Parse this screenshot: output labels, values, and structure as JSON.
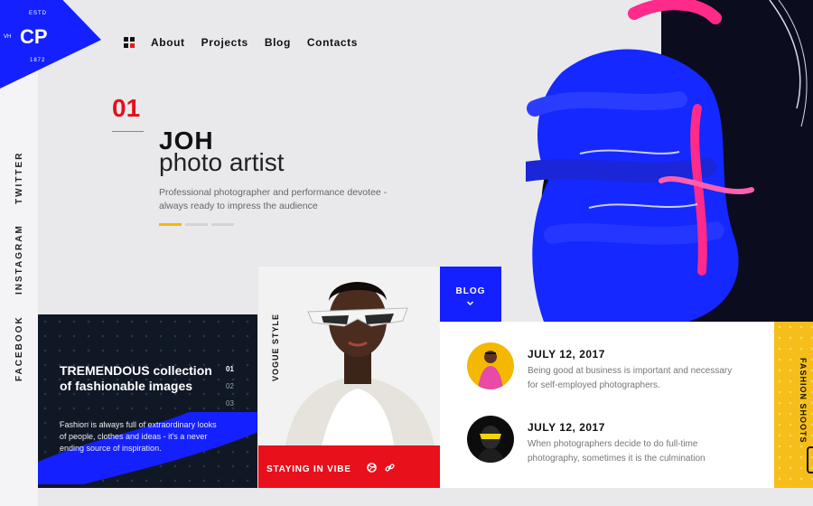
{
  "logo": {
    "estd": "ESTD",
    "mark": "CP",
    "side": "VH",
    "year": "1872"
  },
  "social": [
    "TWITTER",
    "INSTAGRAM",
    "FACEBOOK"
  ],
  "nav": {
    "items": [
      "About",
      "Projects",
      "Blog",
      "Contacts"
    ]
  },
  "hero": {
    "number": "01",
    "title": "JOH",
    "subtitle": "photo artist",
    "description": "Professional photographer and performance devotee - always ready to impress the audience",
    "slides_total": 3,
    "active_slide": 1
  },
  "feature_card": {
    "title": "TREMENDOUS collection of fashionable images",
    "text": "Fashion is always full of extraordinary looks of people, clothes and ideas - it's a never ending source of inspiration.",
    "pager": [
      "01",
      "02",
      "03"
    ],
    "active_page": "01"
  },
  "photo_card": {
    "vertical_label": "VOGUE STYLE",
    "caption": "STAYING IN VIBE",
    "icons": [
      "dribbble-icon",
      "link-icon"
    ]
  },
  "blog_tab": {
    "label": "BLOG"
  },
  "posts": [
    {
      "date": "JULY 12, 2017",
      "text": "Being good at business is important and necessary for self-employed photographers."
    },
    {
      "date": "JULY 12, 2017",
      "text": "When photographers decide to do full-time photography, sometimes it is the culmination"
    }
  ],
  "side_strip": {
    "label": "FASHION SHOOTS"
  },
  "colors": {
    "brand_blue": "#1420ff",
    "accent_red": "#e8101b",
    "accent_yellow": "#f5be1a",
    "dark_card": "#101826"
  }
}
